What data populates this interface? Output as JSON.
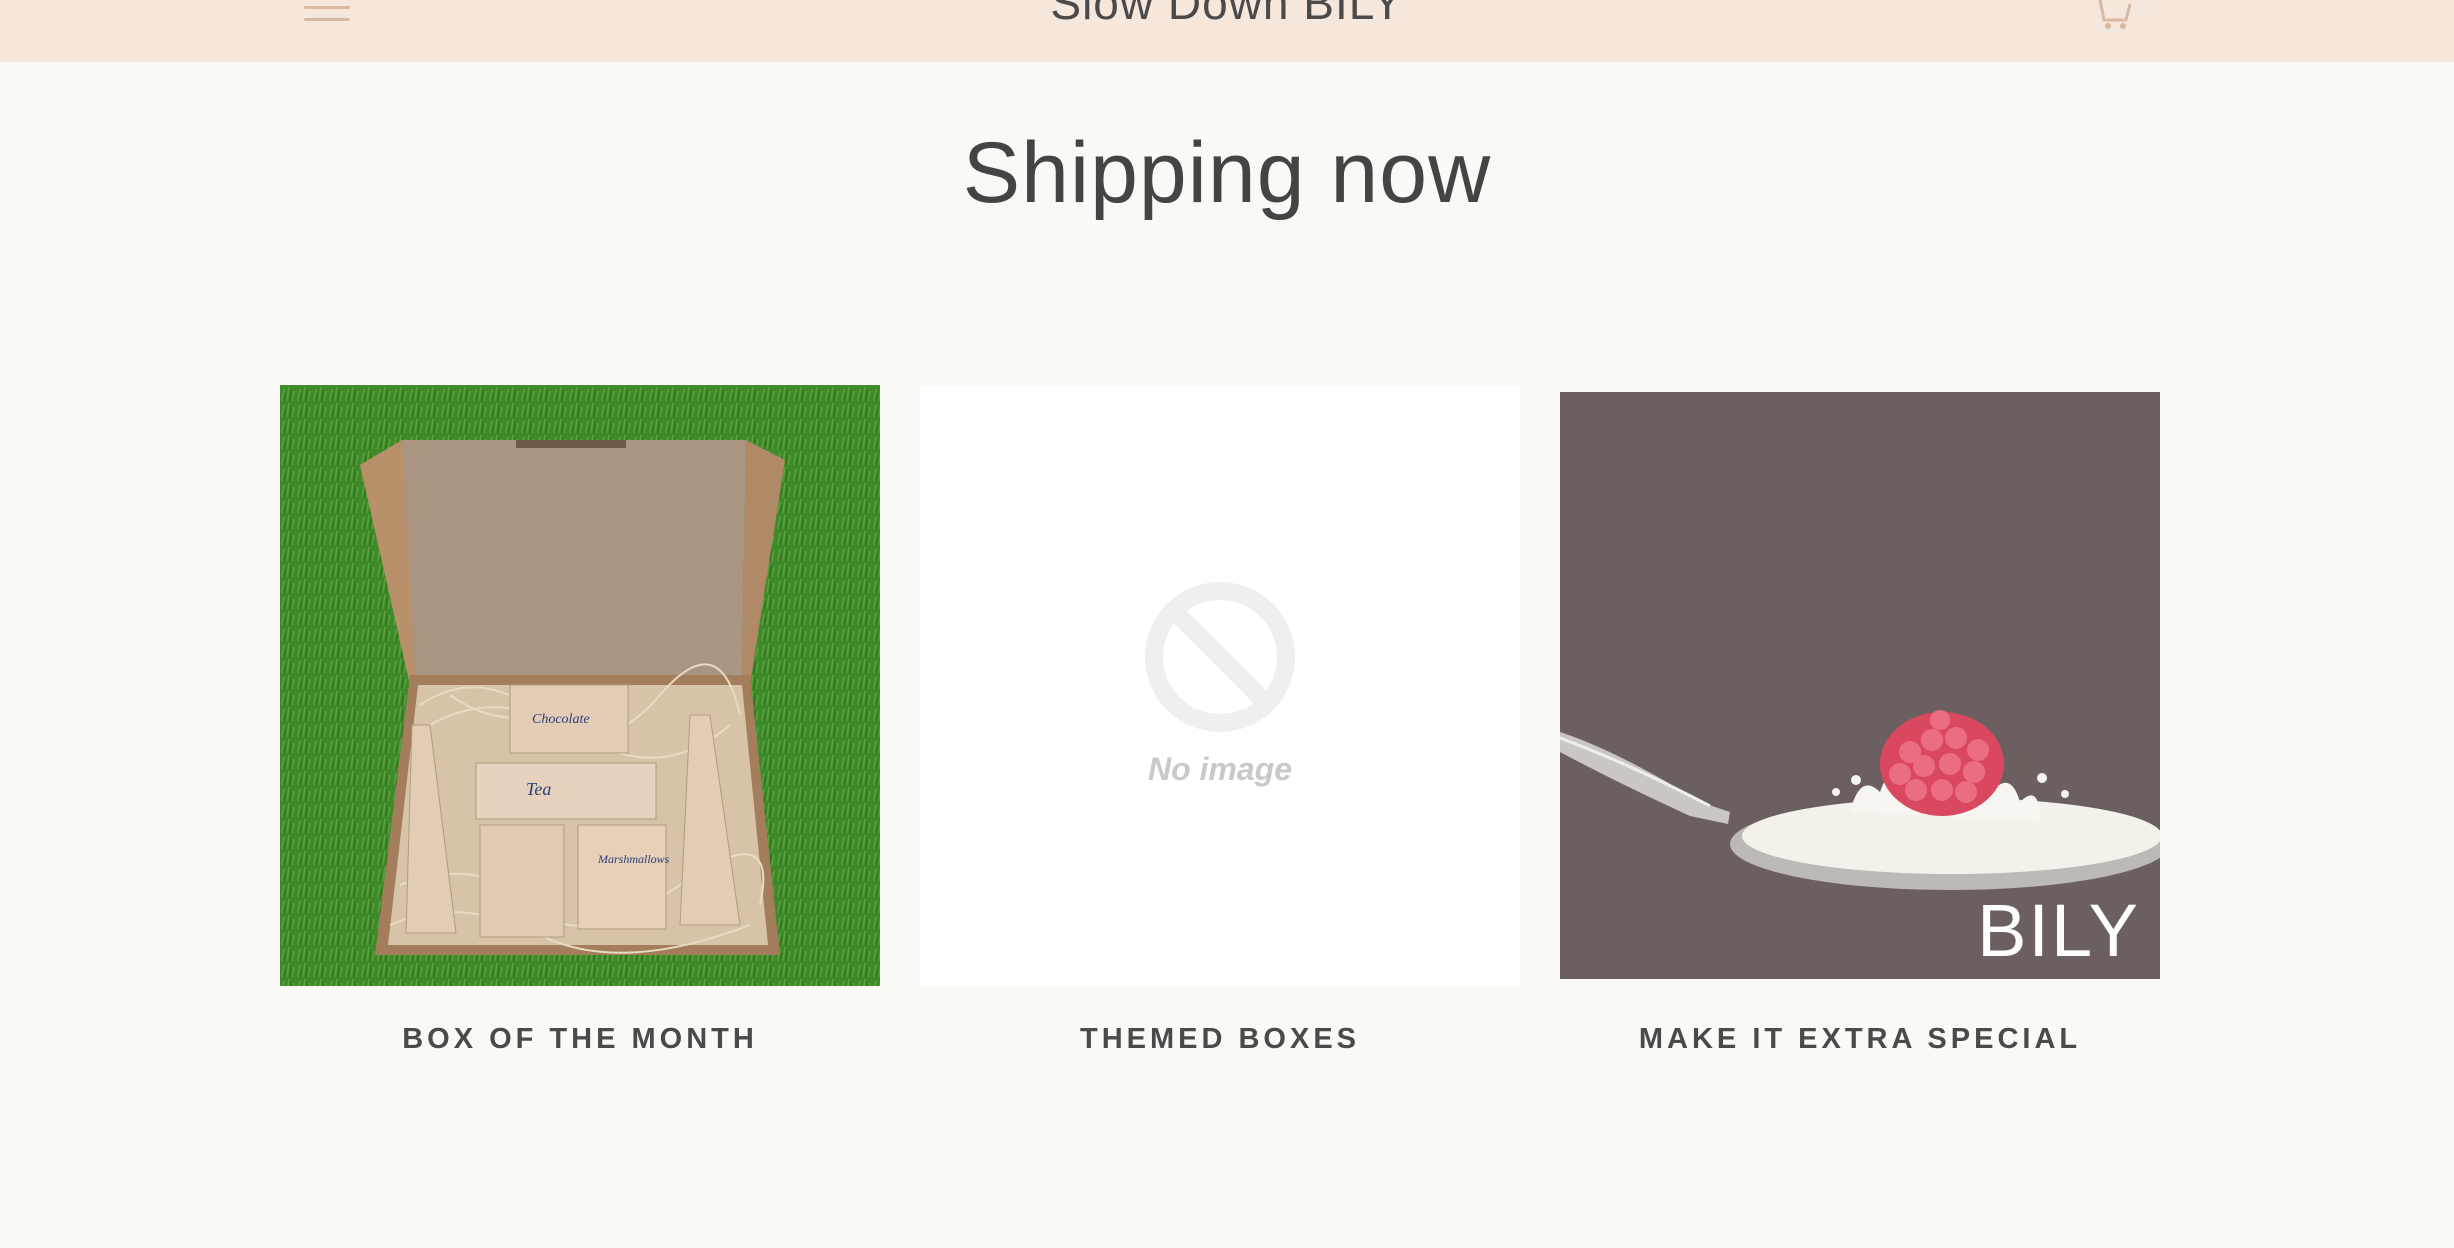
{
  "header": {
    "store_title": "Slow Down BILY",
    "menu_icon": "hamburger-menu-icon",
    "cart_icon": "cart-icon"
  },
  "main": {
    "section_title": "Shipping now",
    "collections": [
      {
        "label": "BOX OF THE MONTH",
        "image": "gift-box-photo"
      },
      {
        "label": "THEMED BOXES",
        "image": "no-image-placeholder",
        "placeholder_caption": "No image"
      },
      {
        "label": "MAKE IT EXTRA SPECIAL",
        "image": "raspberry-spoon-photo",
        "image_logo_text": "BILY"
      }
    ]
  },
  "colors": {
    "header_bg": "#f6e7dd",
    "page_bg": "#faf9f6",
    "header_icon": "#d9b9a1",
    "text": "#444444"
  }
}
